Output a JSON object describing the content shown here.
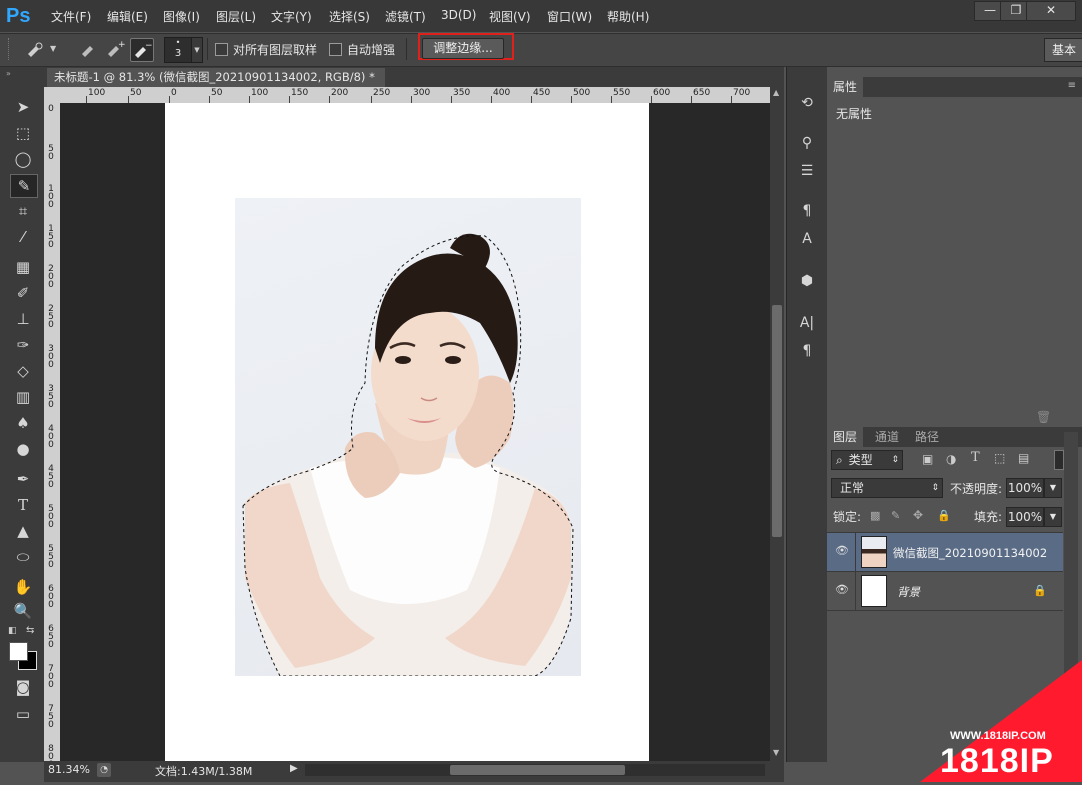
{
  "app": {
    "logo": "Ps"
  },
  "menu": [
    "文件(F)",
    "编辑(E)",
    "图像(I)",
    "图层(L)",
    "文字(Y)",
    "选择(S)",
    "滤镜(T)",
    "3D(D)",
    "视图(V)",
    "窗口(W)",
    "帮助(H)"
  ],
  "window_buttons": {
    "minimize": "—",
    "restore": "❐",
    "close": "✕"
  },
  "options": {
    "brush_size": "3",
    "sample_all_layers_label": "对所有图层取样",
    "auto_enhance_label": "自动增强",
    "refine_edge_button": "调整边缘...",
    "workspace_label": "基本",
    "refine_edge_highlight_color": "#e0201b"
  },
  "document": {
    "tab_title": "未标题-1 @ 81.3% (微信截图_20210901134002, RGB/8) *",
    "close_glyph": "×"
  },
  "ruler_h": [
    "100",
    "50",
    "0",
    "50",
    "100",
    "150",
    "200",
    "250",
    "300",
    "350",
    "400",
    "450",
    "500",
    "550",
    "600",
    "650",
    "700"
  ],
  "ruler_v": [
    "0",
    "5 0",
    "1 0 0",
    "1 5 0",
    "2 0 0",
    "2 5 0",
    "3 0 0",
    "3 5 0",
    "4 0 0",
    "4 5 0",
    "5 0 0",
    "5 5 0",
    "6 0 0",
    "6 5 0",
    "7 0 0",
    "7 5 0",
    "8 0 0"
  ],
  "status": {
    "zoom": "81.34%",
    "doc_info": "文档:1.43M/1.38M"
  },
  "properties_panel": {
    "tab": "属性",
    "content": "无属性"
  },
  "layers_panel": {
    "tabs": [
      "图层",
      "通道",
      "路径"
    ],
    "filter_kind": "类型",
    "blend_mode": "正常",
    "opacity_label": "不透明度:",
    "opacity_value": "100%",
    "lock_label": "锁定:",
    "fill_label": "填充:",
    "fill_value": "100%",
    "layers": [
      {
        "name": "微信截图_20210901134002",
        "selected": true
      },
      {
        "name": "背景",
        "locked": true
      }
    ]
  },
  "watermark": {
    "url": "WWW.1818IP.COM",
    "brand": "1818IP",
    "color": "#ff1a2e"
  },
  "colors": {
    "ps_blue": "#31a8ff",
    "selected_layer": "#596b85"
  }
}
